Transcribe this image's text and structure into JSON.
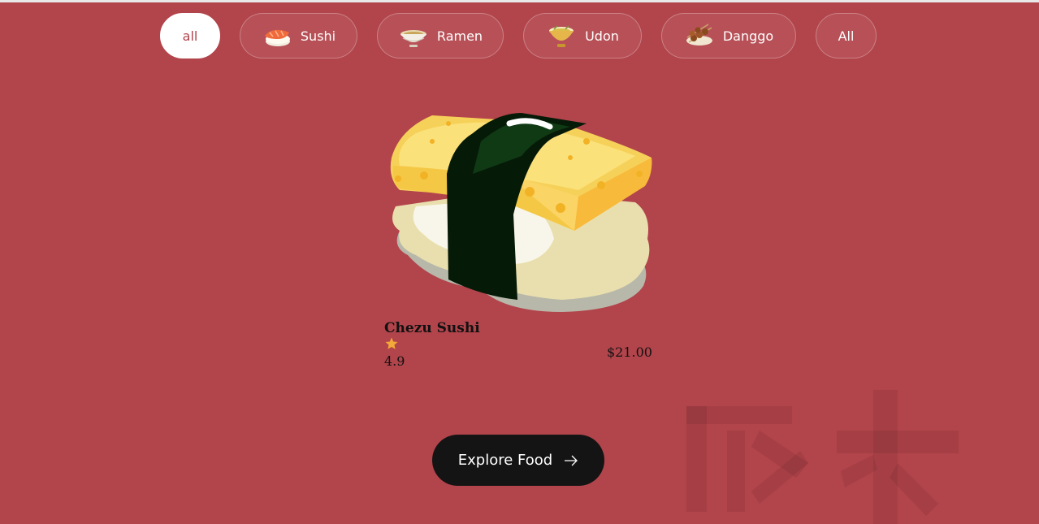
{
  "colors": {
    "background": "#b2444b",
    "active_chip_bg": "#ffffff",
    "button_bg": "#141414"
  },
  "filters": [
    {
      "label": "all",
      "icon": null,
      "active": true
    },
    {
      "label": "Sushi",
      "icon": "sushi-icon",
      "active": false
    },
    {
      "label": "Ramen",
      "icon": "ramen-bowl-icon",
      "active": false
    },
    {
      "label": "Udon",
      "icon": "udon-bowl-icon",
      "active": false
    },
    {
      "label": "Danggo",
      "icon": "dango-skewer-icon",
      "active": false
    },
    {
      "label": "All",
      "icon": null,
      "active": false
    }
  ],
  "product": {
    "image": "tamago-sushi-image",
    "name": "Chezu Sushi",
    "rating": "4.9",
    "price": "$21.00"
  },
  "cta": {
    "label": "Explore Food",
    "icon": "arrow-right-icon"
  }
}
